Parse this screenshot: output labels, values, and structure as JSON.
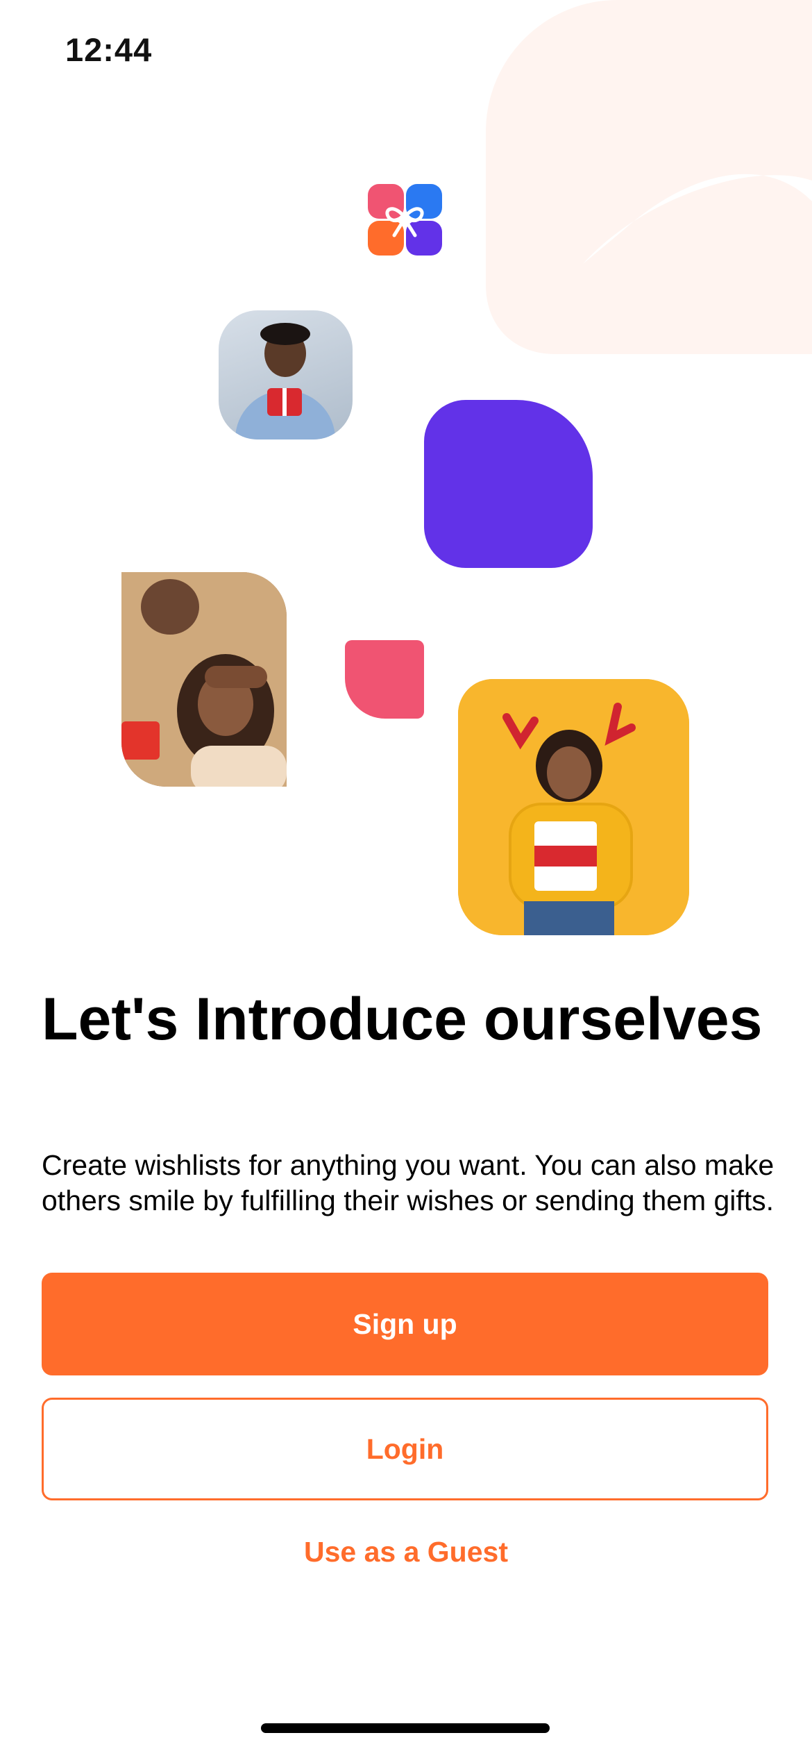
{
  "status_bar": {
    "time": "12:44"
  },
  "onboarding": {
    "title": "Let's Introduce ourselves",
    "description": "Create wishlists for anything you want. You can also make others smile by fulfilling their wishes or sending them gifts.",
    "signup_label": "Sign up",
    "login_label": "Login",
    "guest_label": "Use as a Guest"
  },
  "colors": {
    "accent": "#ff6c2b",
    "purple": "#6232e8",
    "pink": "#f05472",
    "yellow": "#f8b62d",
    "blob": "#fff4f0"
  },
  "icons": [
    "signal-dots-icon",
    "wifi-icon",
    "battery-icon",
    "gift-logo-icon"
  ]
}
